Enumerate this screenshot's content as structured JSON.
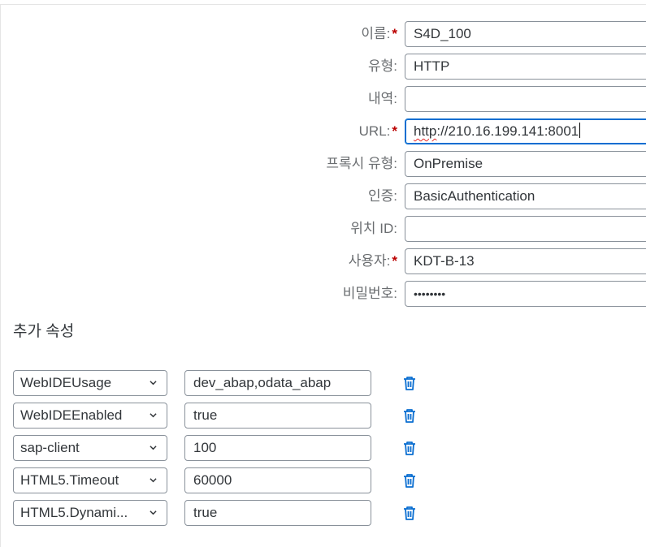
{
  "form": {
    "fields": [
      {
        "label": "이름:",
        "required": true,
        "value": "S4D_100"
      },
      {
        "label": "유형:",
        "required": false,
        "value": "HTTP"
      },
      {
        "label": "내역:",
        "required": false,
        "value": ""
      },
      {
        "label": "URL:",
        "required": true,
        "value_proto": "http",
        "value_rest": "://210.16.199.141:8001"
      },
      {
        "label": "프록시 유형:",
        "required": false,
        "value": "OnPremise"
      },
      {
        "label": "인증:",
        "required": false,
        "value": "BasicAuthentication"
      },
      {
        "label": "위치 ID:",
        "required": false,
        "value": ""
      },
      {
        "label": "사용자:",
        "required": true,
        "value": "KDT-B-13"
      },
      {
        "label": "비밀번호:",
        "required": false,
        "value": "••••••••"
      }
    ],
    "required_marker": "*"
  },
  "additional_properties": {
    "title": "추가 속성",
    "rows": [
      {
        "key": "WebIDEUsage",
        "value": "dev_abap,odata_abap"
      },
      {
        "key": "WebIDEEnabled",
        "value": "true"
      },
      {
        "key": "sap-client",
        "value": "100"
      },
      {
        "key": "HTML5.Timeout",
        "value": "60000"
      },
      {
        "key": "HTML5.Dynami...",
        "value": "true"
      }
    ]
  },
  "icons": {
    "delete": "trash-icon",
    "dropdown": "chevron-down-icon"
  },
  "colors": {
    "accent": "#0a6ed1",
    "required": "#bb0000",
    "label": "#6a6d70"
  }
}
